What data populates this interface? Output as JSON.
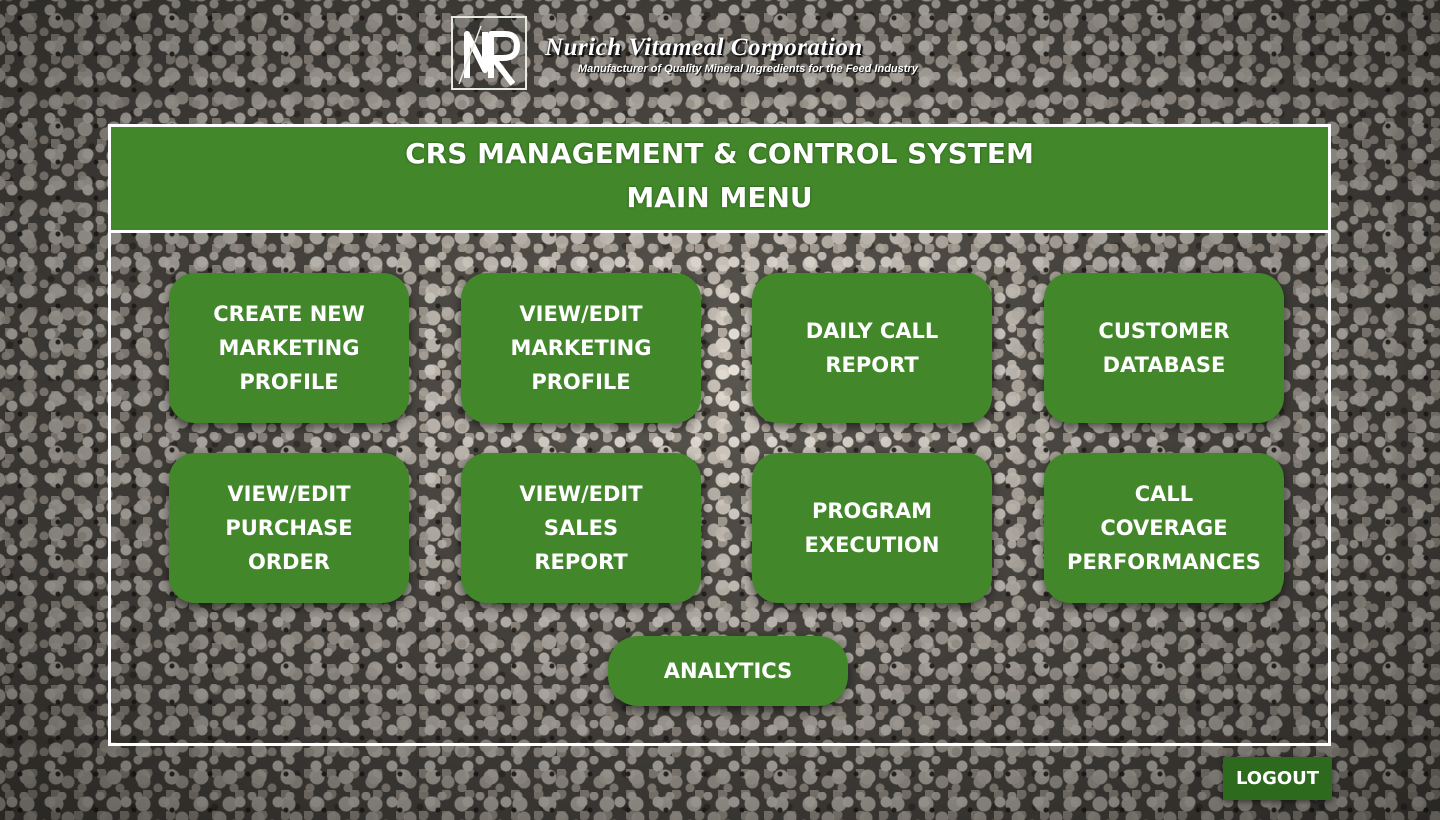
{
  "brand": {
    "logo_letters": "NR",
    "company_name": "Nurich Vitameal Corporation",
    "tagline": "Manufacturer of Quality Mineral Ingredients for the Feed Industry"
  },
  "panel": {
    "title": "CRS MANAGEMENT & CONTROL SYSTEM",
    "subtitle": "MAIN MENU"
  },
  "menu": {
    "items": [
      {
        "label": "CREATE NEW\nMARKETING\nPROFILE"
      },
      {
        "label": "VIEW/EDIT\nMARKETING\nPROFILE"
      },
      {
        "label": "DAILY CALL\nREPORT"
      },
      {
        "label": "CUSTOMER\nDATABASE"
      },
      {
        "label": "VIEW/EDIT\nPURCHASE\nORDER"
      },
      {
        "label": "VIEW/EDIT\nSALES\nREPORT"
      },
      {
        "label": "PROGRAM\nEXECUTION"
      },
      {
        "label": "CALL\nCOVERAGE\nPERFORMANCES"
      }
    ],
    "analytics_label": "ANALYTICS"
  },
  "logout_label": "LOGOUT",
  "colors": {
    "accent_green": "#42872a",
    "logout_green": "#2d6a1d",
    "text": "#ffffff"
  }
}
